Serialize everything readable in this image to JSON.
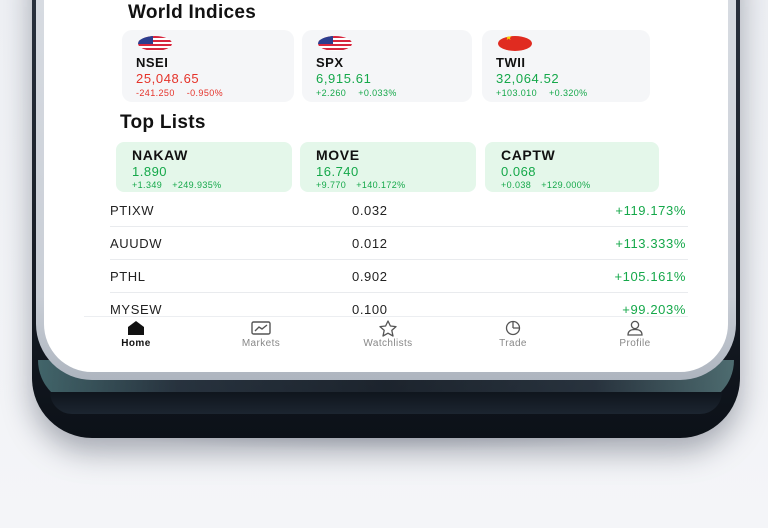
{
  "world_indices": {
    "title": "World Indices",
    "cards": [
      {
        "flag": "us-flag-icon",
        "name": "NSEI",
        "price": "25,048.65",
        "change": "-241.250",
        "change_pct": "-0.950%",
        "direction": "down"
      },
      {
        "flag": "us-flag-icon",
        "name": "SPX",
        "price": "6,915.61",
        "change": "+2.260",
        "change_pct": "+0.033%",
        "direction": "up"
      },
      {
        "flag": "cn-flag-icon",
        "name": "TWII",
        "price": "32,064.52",
        "change": "+103.010",
        "change_pct": "+0.320%",
        "direction": "up"
      }
    ]
  },
  "top_lists": {
    "title": "Top Lists",
    "cards": [
      {
        "name": "NAKAW",
        "price": "1.890",
        "change": "+1.349",
        "change_pct": "+249.935%"
      },
      {
        "name": "MOVE",
        "price": "16.740",
        "change": "+9.770",
        "change_pct": "+140.172%"
      },
      {
        "name": "CAPTW",
        "price": "0.068",
        "change": "+0.038",
        "change_pct": "+129.000%"
      }
    ],
    "rows": [
      {
        "symbol": "PTIXW",
        "price": "0.032",
        "change_pct": "+119.173%"
      },
      {
        "symbol": "AUUDW",
        "price": "0.012",
        "change_pct": "+113.333%"
      },
      {
        "symbol": "PTHL",
        "price": "0.902",
        "change_pct": "+105.161%"
      },
      {
        "symbol": "MYSEW",
        "price": "0.100",
        "change_pct": "+99.203%"
      }
    ]
  },
  "nav": {
    "items": [
      {
        "label": "Home",
        "icon": "home-icon",
        "active": true
      },
      {
        "label": "Markets",
        "icon": "chart-icon",
        "active": false
      },
      {
        "label": "Watchlists",
        "icon": "star-icon",
        "active": false
      },
      {
        "label": "Trade",
        "icon": "pie-icon",
        "active": false
      },
      {
        "label": "Profile",
        "icon": "user-icon",
        "active": false
      }
    ]
  },
  "colors": {
    "up": "#15a84a",
    "down": "#e5332a",
    "top_card_bg": "#e4f7ea",
    "index_card_bg": "#f5f6f8"
  }
}
